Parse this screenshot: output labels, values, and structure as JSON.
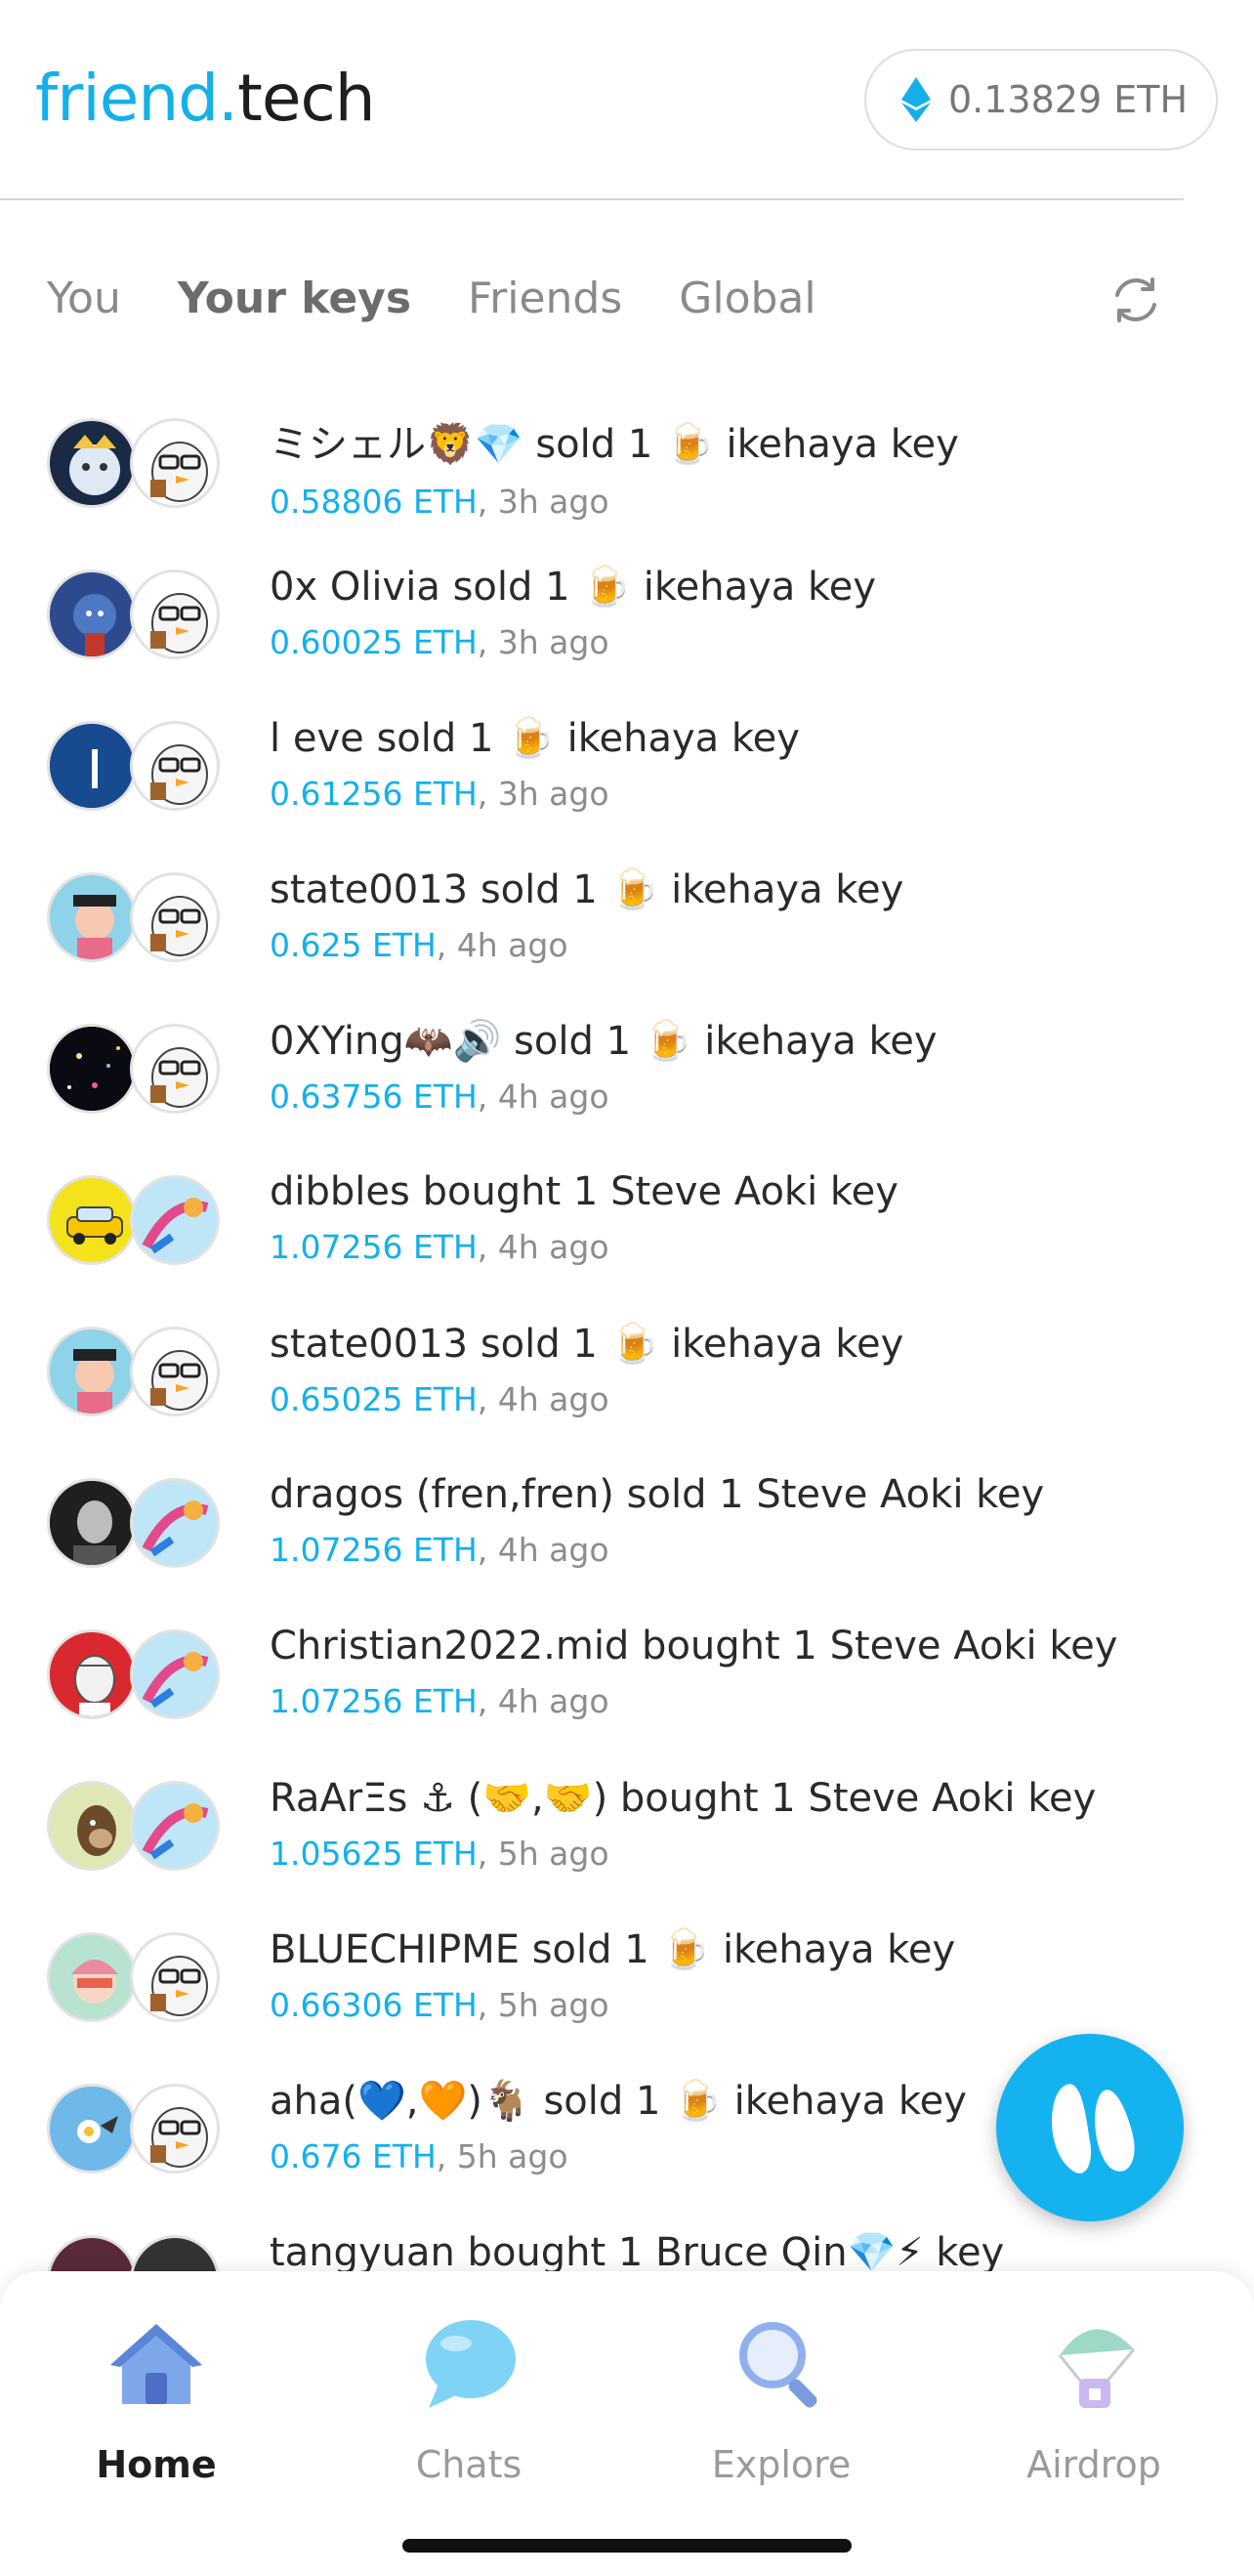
{
  "app": {
    "logo_part1": "friend.",
    "logo_part2": "tech",
    "balance": "0.13829 ETH"
  },
  "tabs": [
    {
      "label": "You",
      "active": false
    },
    {
      "label": "Your keys",
      "active": true
    },
    {
      "label": "Friends",
      "active": false
    },
    {
      "label": "Global",
      "active": false
    }
  ],
  "feed": [
    {
      "actor": "ミシェル🦁💎",
      "action": "sold 1",
      "subject": "🍺 ikehaya",
      "suffix": "key",
      "price": "0.58806 ETH",
      "time": ", 3h ago"
    },
    {
      "actor": "0x Olivia",
      "action": "sold 1",
      "subject": "🍺 ikehaya",
      "suffix": "key",
      "price": "0.60025 ETH",
      "time": ", 3h ago"
    },
    {
      "actor": "l eve",
      "action": "sold 1",
      "subject": "🍺 ikehaya",
      "suffix": "key",
      "price": "0.61256 ETH",
      "time": ", 3h ago"
    },
    {
      "actor": "state0013",
      "action": "sold 1",
      "subject": "🍺 ikehaya",
      "suffix": "key",
      "price": "0.625 ETH",
      "time": ", 4h ago"
    },
    {
      "actor": "0XYing🦇🔊",
      "action": "sold 1",
      "subject": "🍺 ikehaya",
      "suffix": "key",
      "price": "0.63756 ETH",
      "time": ", 4h ago"
    },
    {
      "actor": "dibbles",
      "action": "bought 1",
      "subject": "Steve Aoki",
      "suffix": "key",
      "price": "1.07256 ETH",
      "time": ", 4h ago"
    },
    {
      "actor": "state0013",
      "action": "sold 1",
      "subject": "🍺 ikehaya",
      "suffix": "key",
      "price": "0.65025 ETH",
      "time": ", 4h ago"
    },
    {
      "actor": "dragos (fren,fren)",
      "action": "sold 1",
      "subject": "Steve Aoki",
      "suffix": "key",
      "price": "1.07256 ETH",
      "time": ", 4h ago"
    },
    {
      "actor": "Christian2022.mid",
      "action": "bought 1",
      "subject": "Steve Aoki",
      "suffix": "key",
      "price": "1.07256 ETH",
      "time": ", 4h ago"
    },
    {
      "actor": "RaArΞs ⚓ (🤝,🤝)",
      "action": "bought 1",
      "subject": "Steve Aoki",
      "suffix": "key",
      "price": "1.05625 ETH",
      "time": ", 5h ago"
    },
    {
      "actor": "BLUECHIPME",
      "action": "sold 1",
      "subject": "🍺 ikehaya",
      "suffix": "key",
      "price": "0.66306 ETH",
      "time": ", 5h ago"
    },
    {
      "actor": "aha(💙,🧡)🐐",
      "action": "sold 1",
      "subject": "🍺 ikehaya",
      "suffix": "key",
      "price": "0.676 ETH",
      "time": ", 5h ago"
    },
    {
      "actor": "tangyuan",
      "action": "bought 1",
      "subject": "Bruce Qin💎⚡",
      "suffix": "key",
      "price": "",
      "time": ""
    }
  ],
  "bottom_nav": [
    {
      "label": "Home",
      "icon": "home-icon",
      "active": true
    },
    {
      "label": "Chats",
      "icon": "chat-bubble-icon",
      "active": false
    },
    {
      "label": "Explore",
      "icon": "magnifier-icon",
      "active": false
    },
    {
      "label": "Airdrop",
      "icon": "parachute-icon",
      "active": false
    }
  ],
  "colors": {
    "accent": "#14b0ea",
    "text": "#2a2a2a",
    "muted": "#8c8c8c"
  }
}
